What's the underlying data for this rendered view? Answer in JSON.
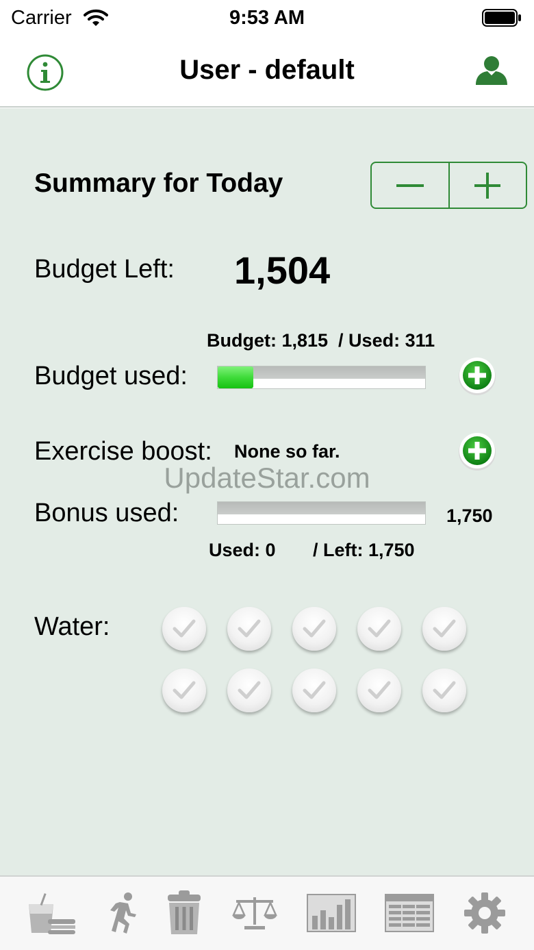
{
  "status_bar": {
    "carrier": "Carrier",
    "time": "9:53 AM"
  },
  "nav": {
    "title": "User - default",
    "left_icon": "info-icon",
    "right_icon": "user-icon"
  },
  "summary": {
    "title": "Summary for Today"
  },
  "budget_left": {
    "label": "Budget Left:",
    "value": "1,504"
  },
  "budget_used": {
    "stats": "Budget: 1,815  / Used: 311",
    "label": "Budget used:",
    "fraction": 0.171
  },
  "exercise": {
    "label": "Exercise boost:",
    "value": "None so far."
  },
  "watermark": "UpdateStar.com",
  "bonus": {
    "label": "Bonus used:",
    "total": "1,750",
    "used": "Used: 0",
    "left": "/ Left: 1,750",
    "fraction": 0
  },
  "water": {
    "label": "Water:",
    "cups": 10
  },
  "tabs": [
    "food-icon",
    "exercise-icon",
    "trash-icon",
    "scale-icon",
    "chart-icon",
    "log-icon",
    "settings-icon"
  ],
  "colors": {
    "accent": "#2f8a36",
    "content_bg": "#e3ece6",
    "tab_icon": "#9b9b9b"
  }
}
